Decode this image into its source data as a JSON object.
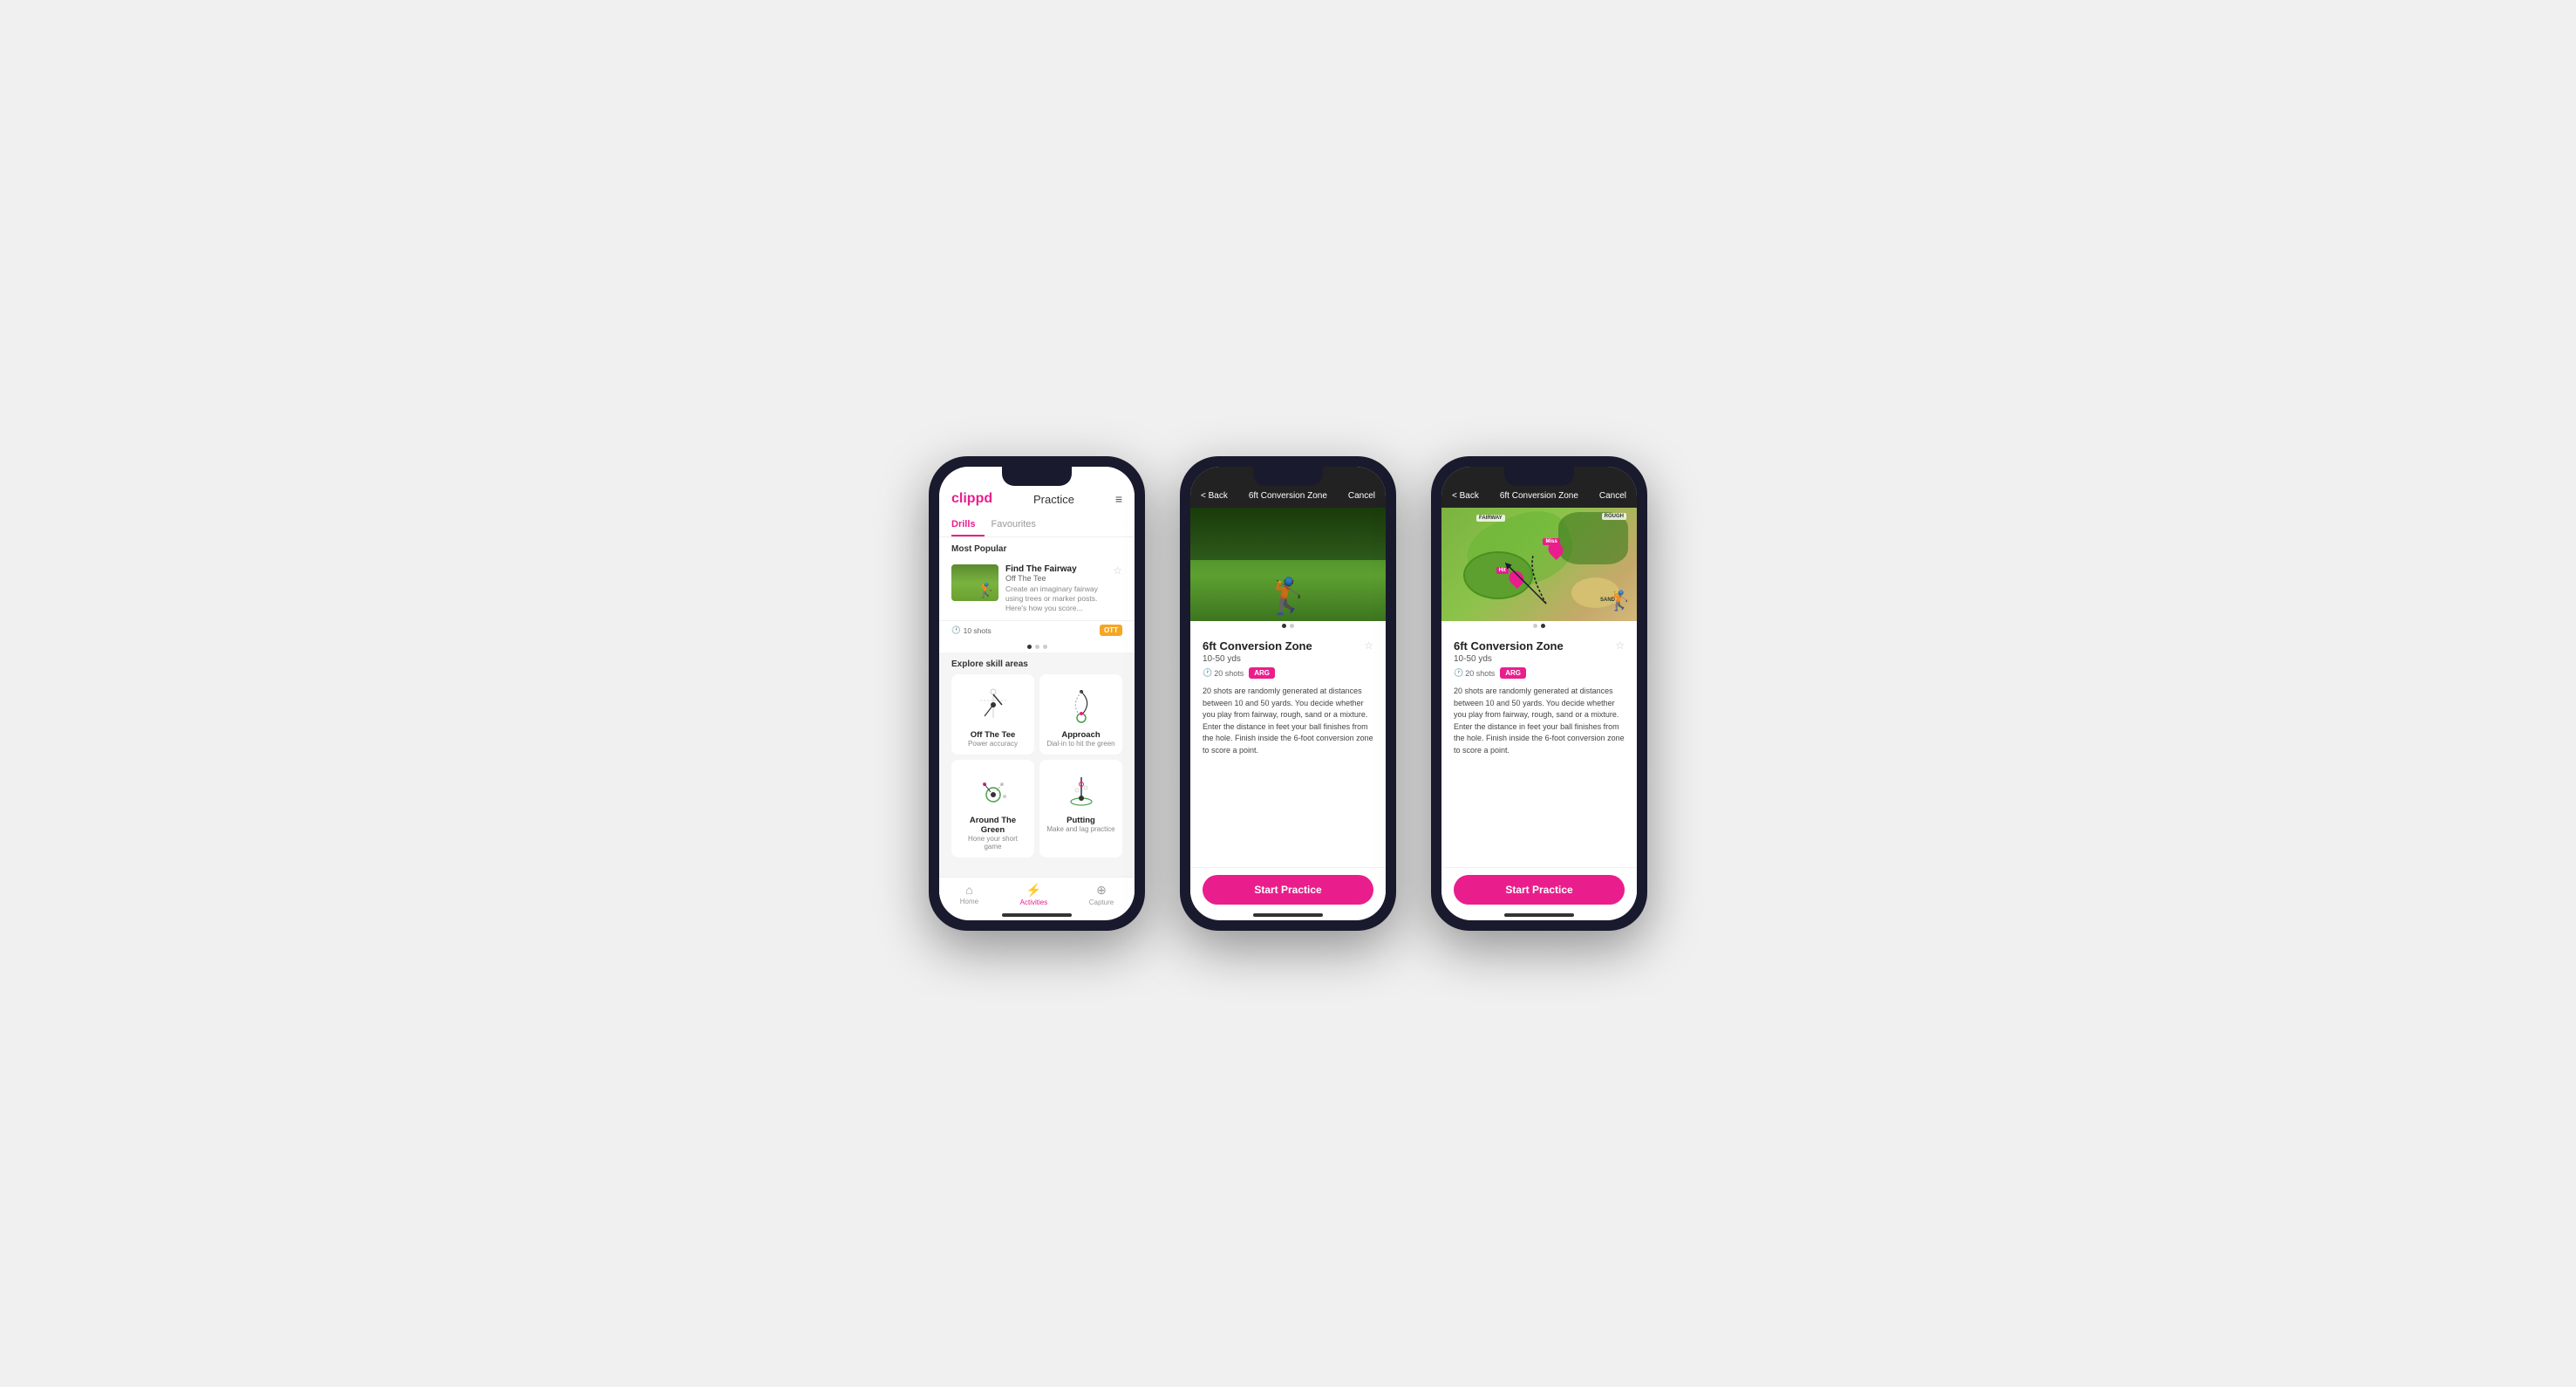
{
  "phone1": {
    "header": {
      "logo": "clippd",
      "title": "Practice",
      "menu_icon": "≡"
    },
    "tabs": [
      {
        "label": "Drills",
        "active": true
      },
      {
        "label": "Favourites",
        "active": false
      }
    ],
    "most_popular": {
      "section_title": "Most Popular",
      "drill": {
        "name": "Find The Fairway",
        "subtitle": "Off The Tee",
        "description": "Create an imaginary fairway using trees or marker posts. Here's how you score...",
        "shots": "10 shots",
        "tag": "OTT"
      }
    },
    "explore": {
      "section_title": "Explore skill areas",
      "skills": [
        {
          "name": "Off The Tee",
          "desc": "Power accuracy"
        },
        {
          "name": "Approach",
          "desc": "Dial-in to hit the green"
        },
        {
          "name": "Around The Green",
          "desc": "Hone your short game"
        },
        {
          "name": "Putting",
          "desc": "Make and lag practice"
        }
      ]
    },
    "nav": [
      {
        "label": "Home",
        "icon": "⌂",
        "active": false
      },
      {
        "label": "Activities",
        "icon": "⚡",
        "active": true
      },
      {
        "label": "Capture",
        "icon": "+",
        "active": false
      }
    ]
  },
  "phone2": {
    "header": {
      "back": "< Back",
      "title": "6ft Conversion Zone",
      "cancel": "Cancel"
    },
    "image_type": "photo",
    "img_dots": [
      "active",
      "inactive"
    ],
    "drill": {
      "name": "6ft Conversion Zone",
      "range": "10-50 yds",
      "shots": "20 shots",
      "tag": "ARG",
      "description": "20 shots are randomly generated at distances between 10 and 50 yards. You decide whether you play from fairway, rough, sand or a mixture. Enter the distance in feet your ball finishes from the hole. Finish inside the 6-foot conversion zone to score a point."
    },
    "start_btn": "Start Practice"
  },
  "phone3": {
    "header": {
      "back": "< Back",
      "title": "6ft Conversion Zone",
      "cancel": "Cancel"
    },
    "image_type": "map",
    "img_dots": [
      "inactive",
      "active"
    ],
    "drill": {
      "name": "6ft Conversion Zone",
      "range": "10-50 yds",
      "shots": "20 shots",
      "tag": "ARG",
      "description": "20 shots are randomly generated at distances between 10 and 50 yards. You decide whether you play from fairway, rough, sand or a mixture. Enter the distance in feet your ball finishes from the hole. Finish inside the 6-foot conversion zone to score a point."
    },
    "map_labels": {
      "fairway": "FAIRWAY",
      "rough": "ROUGH",
      "sand": "SAND",
      "hit": "Hit",
      "miss": "Miss"
    },
    "start_btn": "Start Practice"
  }
}
